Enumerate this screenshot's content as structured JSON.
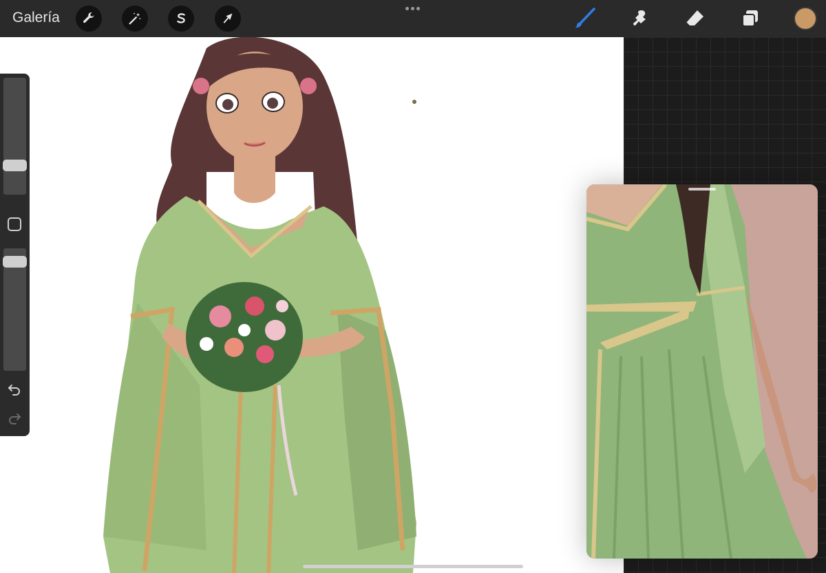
{
  "toolbar": {
    "gallery_label": "Galería",
    "left_tools": [
      "wrench-icon",
      "magic-wand-icon",
      "selection-s-icon",
      "transform-arrow-icon"
    ],
    "right_tools": [
      "brush-icon",
      "smudge-icon",
      "eraser-icon",
      "layers-icon"
    ],
    "active_tool": "brush-icon",
    "current_color": "#c99a66",
    "accent_color": "#2f7ee6"
  },
  "sidebar": {
    "brush_size_level": 0.22,
    "opacity_level": 0.93,
    "icons": [
      "modify-square-icon",
      "undo-icon",
      "redo-icon"
    ]
  },
  "reference": {
    "title": "",
    "colors": {
      "background": "#c9a49a",
      "dress": "#8fb57a",
      "trim": "#d8c68a"
    }
  },
  "artwork": {
    "colors": {
      "hair": "#5a3636",
      "skin": "#d9a788",
      "dress": "#9fc07f",
      "trim": "#cfa566"
    }
  }
}
